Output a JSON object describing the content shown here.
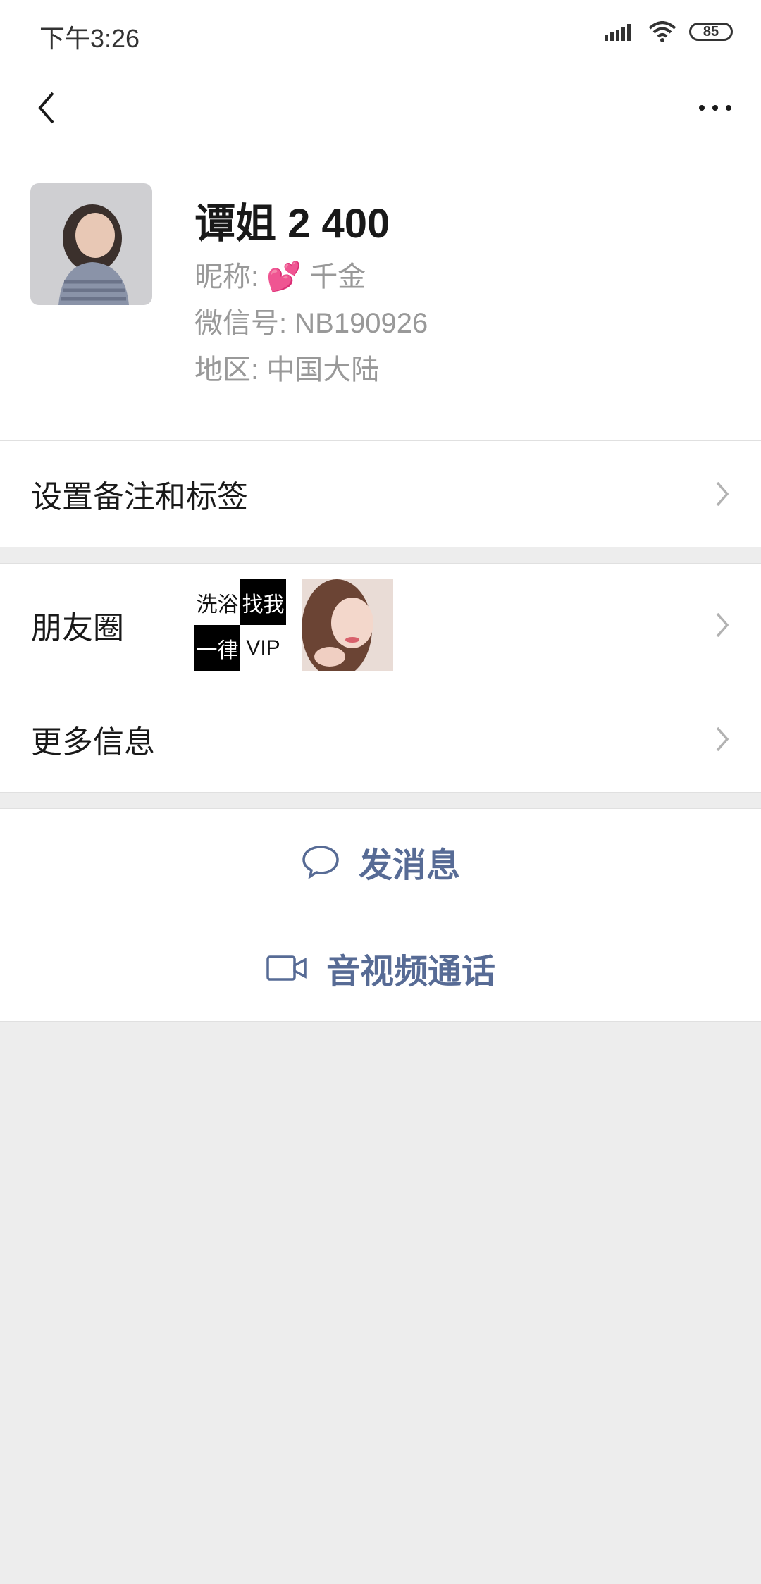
{
  "status": {
    "time": "下午3:26",
    "battery": "85"
  },
  "profile": {
    "name": "谭姐 2 400",
    "nickname_label": "昵称:",
    "nickname_emoji": "💕",
    "nickname": "千金",
    "wxid_label": "微信号:",
    "wxid": "NB190926",
    "region_label": "地区:",
    "region": "中国大陆"
  },
  "rows": {
    "remark": "设置备注和标签",
    "moments": "朋友圈",
    "more_info": "更多信息"
  },
  "moments_thumb": {
    "cells": [
      "洗浴",
      "找我",
      "一律",
      "VIP"
    ]
  },
  "actions": {
    "message": "发消息",
    "call": "音视频通话"
  },
  "colors": {
    "link": "#576b95",
    "background": "#ededed"
  }
}
